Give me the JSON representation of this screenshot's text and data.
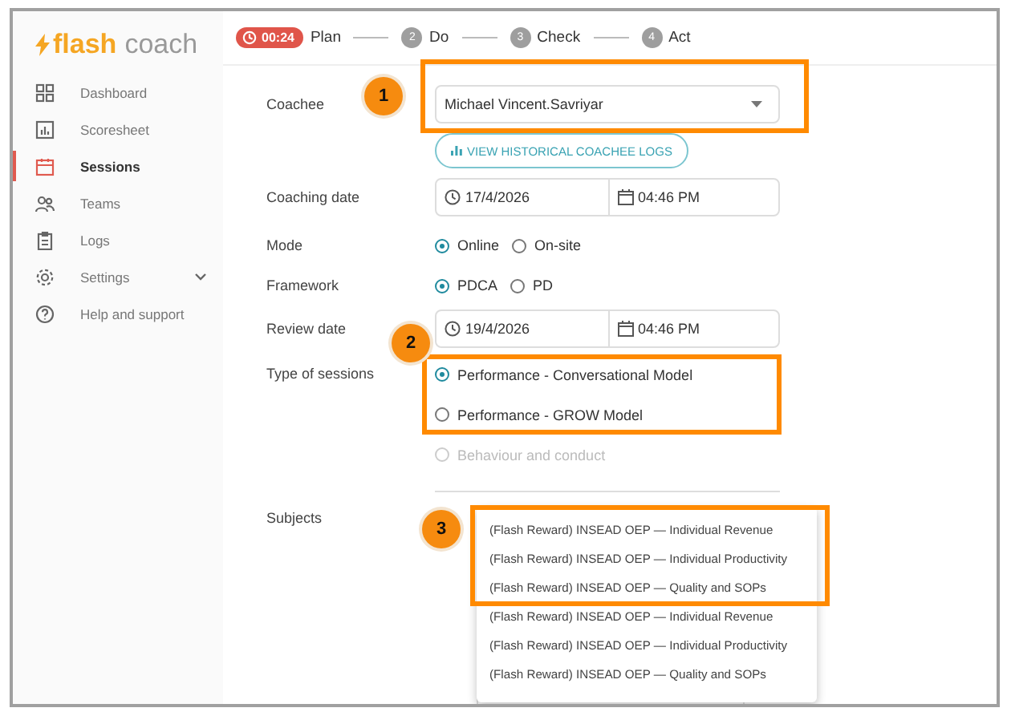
{
  "logo": {
    "primary": "flash",
    "secondary": "coach"
  },
  "steps": [
    {
      "kind": "timer",
      "badge": "00:24",
      "label": "Plan"
    },
    {
      "kind": "number",
      "badge": "2",
      "label": "Do"
    },
    {
      "kind": "number",
      "badge": "3",
      "label": "Check"
    },
    {
      "kind": "number",
      "badge": "4",
      "label": "Act"
    }
  ],
  "sidebar": {
    "items": [
      {
        "kind": "link",
        "label": "Dashboard",
        "selected": false
      },
      {
        "kind": "link",
        "label": "Scoresheet",
        "selected": false
      },
      {
        "kind": "link",
        "label": "Sessions",
        "selected": true
      },
      {
        "kind": "link",
        "label": "Teams",
        "selected": false
      },
      {
        "kind": "link",
        "label": "Logs",
        "selected": false
      },
      {
        "kind": "group",
        "label": "Settings",
        "selected": false
      },
      {
        "kind": "link",
        "label": "Help and support",
        "selected": false
      }
    ]
  },
  "form": {
    "coachee": {
      "label": "Coachee",
      "value": "Michael Vincent.Savriyar",
      "annotation": "1"
    },
    "history_button": "VIEW HISTORICAL COACHEE LOGS",
    "coaching_date": {
      "label": "Coaching date",
      "date": "17/4/2026",
      "time": "04:46 PM"
    },
    "mode": {
      "label": "Mode",
      "options": [
        {
          "label": "Online",
          "selected": true
        },
        {
          "label": "On-site",
          "selected": false
        }
      ]
    },
    "framework": {
      "label": "Framework",
      "options": [
        {
          "label": "PDCA",
          "selected": true
        },
        {
          "label": "PD",
          "selected": false
        }
      ]
    },
    "review_date": {
      "label": "Review date",
      "date": "19/4/2026",
      "time": "04:46 PM"
    },
    "session_type": {
      "label": "Type of sessions",
      "annotation": "2",
      "options": [
        {
          "label": "Performance - Conversational Model",
          "selected": true,
          "disabled": false
        },
        {
          "label": "Performance - GROW Model",
          "selected": false,
          "disabled": false
        },
        {
          "label": "Behaviour and conduct",
          "selected": false,
          "disabled": true
        }
      ]
    },
    "subjects": {
      "label": "Subjects",
      "annotation": "3",
      "annotated_options": [
        "(Flash Reward) INSEAD OEP — Individual Revenue",
        "(Flash Reward) INSEAD OEP — Individual Productivity",
        "(Flash Reward) INSEAD OEP — Quality and SOPs"
      ],
      "other_options": [
        "(Flash Reward) INSEAD OEP — Individual Revenue",
        "(Flash Reward) INSEAD OEP — Individual Productivity",
        "(Flash Reward) INSEAD OEP — Quality and SOPs"
      ]
    }
  }
}
